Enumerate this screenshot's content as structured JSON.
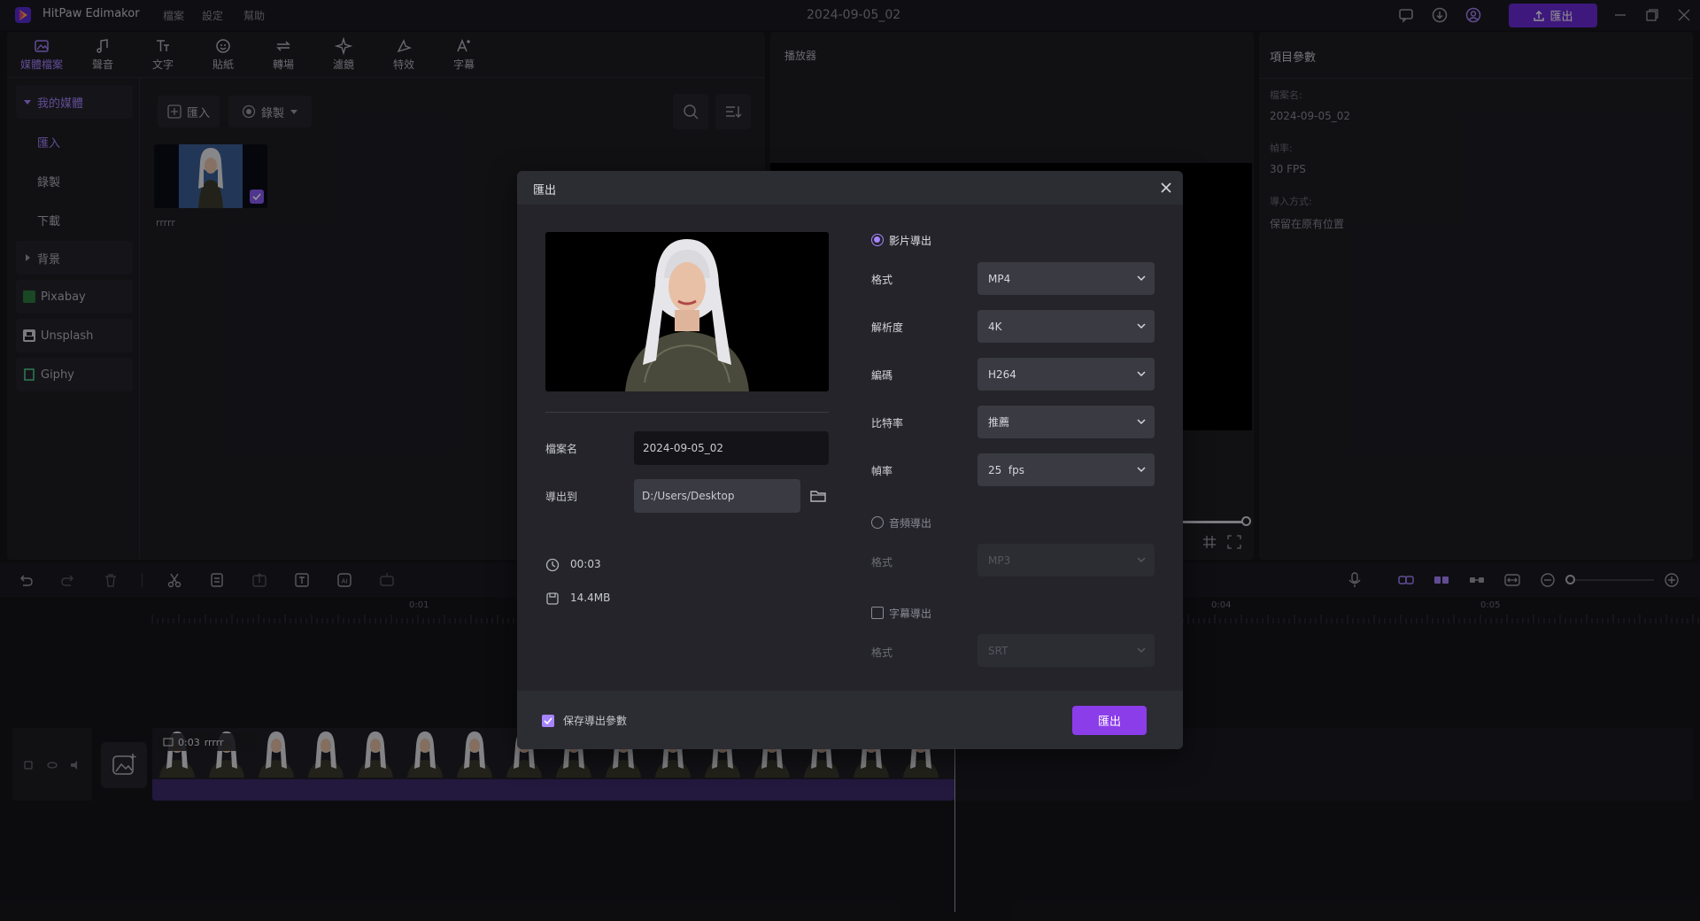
{
  "app": {
    "name": "HitPaw Edimakor",
    "menu": [
      "檔案",
      "設定",
      "幫助"
    ],
    "doc_title": "2024-09-05_02",
    "export_label": "匯出"
  },
  "tools": [
    {
      "label": "媒體檔案",
      "active": true,
      "icon": "media-icon"
    },
    {
      "label": "聲音",
      "active": false,
      "icon": "music-note-icon"
    },
    {
      "label": "文字",
      "active": false,
      "icon": "text-icon"
    },
    {
      "label": "貼紙",
      "active": false,
      "icon": "sticker-icon"
    },
    {
      "label": "轉場",
      "active": false,
      "icon": "transition-icon"
    },
    {
      "label": "濾鏡",
      "active": false,
      "icon": "filter-icon"
    },
    {
      "label": "特效",
      "active": false,
      "icon": "effects-icon"
    },
    {
      "label": "字幕",
      "active": false,
      "icon": "subtitle-icon"
    }
  ],
  "sidebar": {
    "my_media": "我的媒體",
    "import": "匯入",
    "record": "錄製",
    "download": "下載",
    "background": "背景",
    "pixabay": "Pixabay",
    "unsplash": "Unsplash",
    "giphy": "Giphy"
  },
  "media": {
    "import_btn": "匯入",
    "record_btn": "錄製",
    "item_name": "rrrrr"
  },
  "player": {
    "title": "播放器"
  },
  "params": {
    "title": "項目參數",
    "filename_label": "檔案名:",
    "filename_value": "2024-09-05_02",
    "framerate_label": "幀率:",
    "framerate_value": "30 FPS",
    "import_mode_label": "導入方式:",
    "import_mode_value": "保留在原有位置"
  },
  "timeline": {
    "ruler_labels": [
      "0:01",
      "0:04",
      "0:05"
    ],
    "clip_duration": "0:03",
    "clip_name": "rrrrr"
  },
  "dialog": {
    "title": "匯出",
    "filename_label": "檔案名",
    "filename_value": "2024-09-05_02",
    "export_to_label": "導出到",
    "export_to_value": "D:/Users/Desktop",
    "duration": "00:03",
    "size": "14.4MB",
    "video_export_label": "影片導出",
    "video_export_selected": true,
    "format_label": "格式",
    "format_value": "MP4",
    "resolution_label": "解析度",
    "resolution_value": "4K",
    "codec_label": "編碼",
    "codec_value": "H264",
    "bitrate_label": "比特率",
    "bitrate_value": "推薦",
    "framerate_label": "幀率",
    "framerate_value": "25  fps",
    "audio_export_label": "音頻導出",
    "audio_format_label": "格式",
    "audio_format_value": "MP3",
    "subtitle_export_label": "字幕導出",
    "subtitle_format_label": "格式",
    "subtitle_format_value": "SRT",
    "save_params_label": "保存導出參數",
    "save_params_checked": true,
    "export_button": "匯出"
  },
  "colors": {
    "accent": "#8b3dea",
    "accent_light": "#a784ff",
    "bg": "#16161b",
    "panel": "#1e1e24"
  }
}
